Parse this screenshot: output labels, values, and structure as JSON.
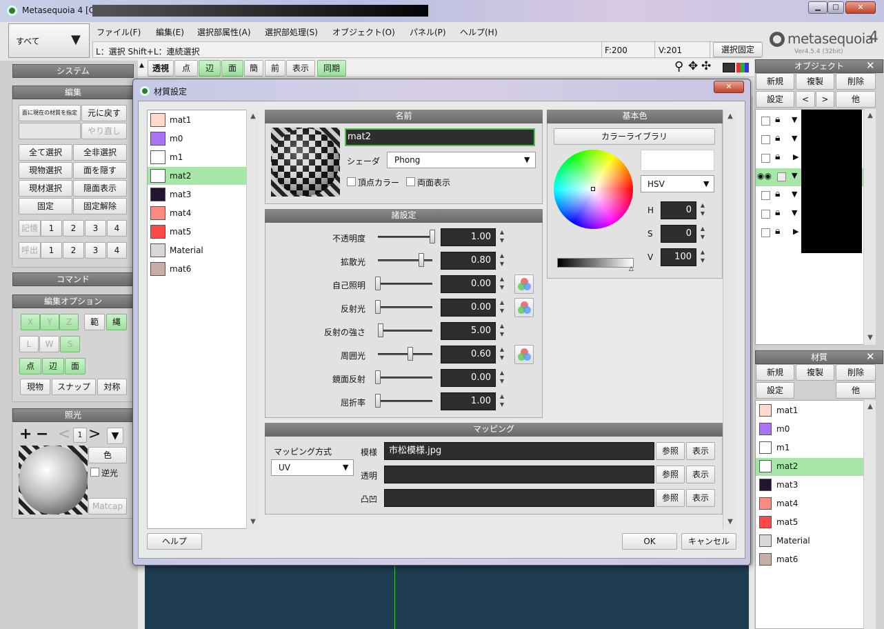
{
  "window": {
    "title": "Metasequoia 4 [C"
  },
  "logo": {
    "text": "metasequoia",
    "num": "4",
    "version": "Ver4.5.4 (32bit)"
  },
  "mode_select": "すべて",
  "menu": [
    "ファイル(F)",
    "編集(E)",
    "選択部属性(A)",
    "選択部処理(S)",
    "オブジェクト(O)",
    "パネル(P)",
    "ヘルプ(H)"
  ],
  "status": {
    "hint": "L：選択 Shift+L：連続選択",
    "faces": "F:200",
    "verts": "V:201",
    "fix": "選択固定"
  },
  "viewbar": [
    "透視",
    "点",
    "辺",
    "面",
    "簡",
    "前",
    "表示",
    "同期"
  ],
  "left": {
    "system": "システム",
    "edit": "編集",
    "edit_btns": [
      "面に現在の材質を指定",
      "元に戻す",
      "やり直し",
      "全て選択",
      "全非選択",
      "現物選択",
      "面を隠す",
      "現材選択",
      "隠面表示",
      "固定",
      "固定解除"
    ],
    "mem": "記憶",
    "call": "呼出",
    "nums": [
      "1",
      "2",
      "3",
      "4"
    ],
    "command": "コマンド",
    "editopt": "編集オプション",
    "xyz": [
      "X",
      "Y",
      "Z"
    ],
    "range": "範",
    "rope": "縄",
    "lws": [
      "L",
      "W",
      "S"
    ],
    "pef": [
      "点",
      "辺",
      "面"
    ],
    "snap": [
      "現物",
      "スナップ",
      "対称"
    ],
    "light": "照光",
    "light_num": "1",
    "color_btn": "色",
    "reverse": "逆光",
    "matcap": "Matcap"
  },
  "right": {
    "object": "オブジェクト",
    "obj_btns": [
      "新規",
      "複製",
      "削除",
      "設定",
      "<",
      ">",
      "他"
    ],
    "material": "材質",
    "mat_btns": [
      "新規",
      "複製",
      "削除",
      "設定",
      "他"
    ],
    "materials": [
      {
        "name": "mat1",
        "color": "#ffd9c9"
      },
      {
        "name": "m0",
        "color": "#a972f7"
      },
      {
        "name": "m1",
        "color": "#ffffff"
      },
      {
        "name": "mat2",
        "color": "#ffffff"
      },
      {
        "name": "mat3",
        "color": "#221433"
      },
      {
        "name": "mat4",
        "color": "#fb8b7e"
      },
      {
        "name": "mat5",
        "color": "#ff4848"
      },
      {
        "name": "Material",
        "color": "#d8d8d8"
      },
      {
        "name": "mat6",
        "color": "#c7ada4"
      }
    ],
    "selected": "mat2"
  },
  "dialog": {
    "title": "材質設定",
    "name_header": "名前",
    "name_value": "mat2",
    "shader_label": "シェーダ",
    "shader_value": "Phong",
    "vertex_color": "頂点カラー",
    "double_side": "両面表示",
    "settings_header": "諸設定",
    "params": [
      {
        "label": "不透明度",
        "value": "1.00",
        "pos": 1.0,
        "icon": false
      },
      {
        "label": "拡散光",
        "value": "0.80",
        "pos": 0.8,
        "icon": false
      },
      {
        "label": "自己照明",
        "value": "0.00",
        "pos": 0.0,
        "icon": true
      },
      {
        "label": "反射光",
        "value": "0.00",
        "pos": 0.0,
        "icon": true
      },
      {
        "label": "反射の強さ",
        "value": "5.00",
        "pos": 0.05,
        "icon": false
      },
      {
        "label": "周囲光",
        "value": "0.60",
        "pos": 0.6,
        "icon": true
      },
      {
        "label": "鏡面反射",
        "value": "0.00",
        "pos": 0.0,
        "icon": false
      },
      {
        "label": "屈折率",
        "value": "1.00",
        "pos": 0.0,
        "icon": false
      }
    ],
    "basecolor_header": "基本色",
    "color_library": "カラーライブラリ",
    "color_mode": "HSV",
    "hsv": [
      {
        "k": "H",
        "v": "0"
      },
      {
        "k": "S",
        "v": "0"
      },
      {
        "k": "V",
        "v": "100"
      }
    ],
    "mapping_header": "マッピング",
    "mapping_method_label": "マッピング方式",
    "mapping_method": "UV",
    "maps": [
      {
        "label": "模様",
        "value": "市松模様.jpg"
      },
      {
        "label": "透明",
        "value": ""
      },
      {
        "label": "凸凹",
        "value": ""
      }
    ],
    "browse": "参照",
    "show": "表示",
    "help": "ヘルプ",
    "ok": "OK",
    "cancel": "キャンセル",
    "close": "x"
  }
}
